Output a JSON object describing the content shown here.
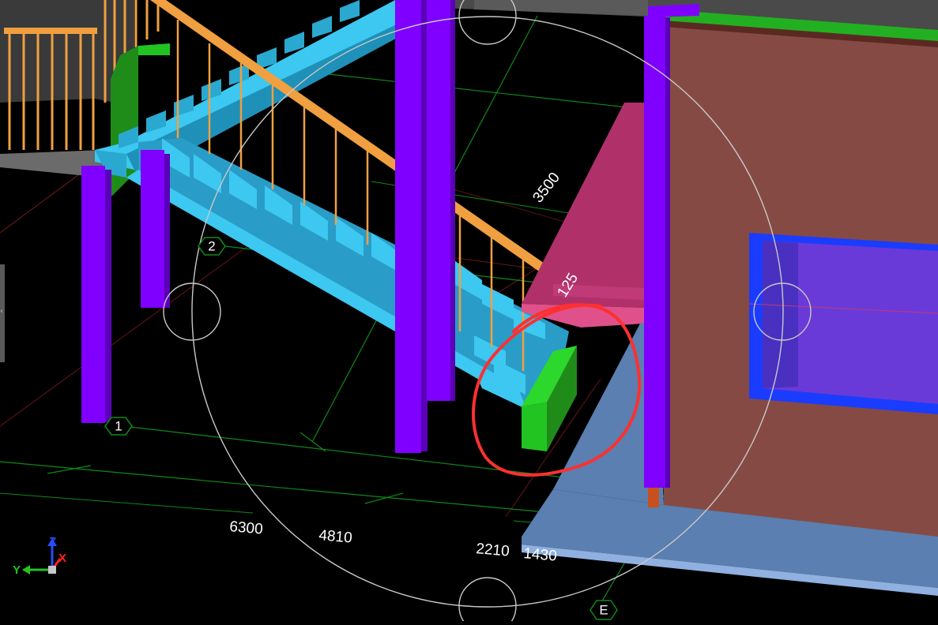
{
  "viewport": {
    "background": "#000000",
    "dimensions": [
      "3500",
      "125",
      "6300",
      "4810",
      "2210",
      "1430"
    ],
    "grid_labels": [
      "2",
      "1",
      "E"
    ],
    "axis": {
      "z": "Z",
      "y": "Y",
      "x": "X"
    },
    "colors": {
      "column": "#7f00ff",
      "stair": "#3cc8f0",
      "railing": "#f0a040",
      "landing": "#e0508a",
      "wall": "#864a44",
      "window": "#6a3ad8",
      "window_frame": "#1a3cff",
      "slab": "#5a7fb0",
      "green_beam": "#22c422",
      "grid_green": "#0f8a18",
      "grid_red": "#7a1a1a",
      "annotation": "#ff3030",
      "gizmo": "#c8c8c8"
    },
    "icons": [
      "orbit-gizmo",
      "axis-triad-icon",
      "collapse-arrow-icon"
    ]
  }
}
